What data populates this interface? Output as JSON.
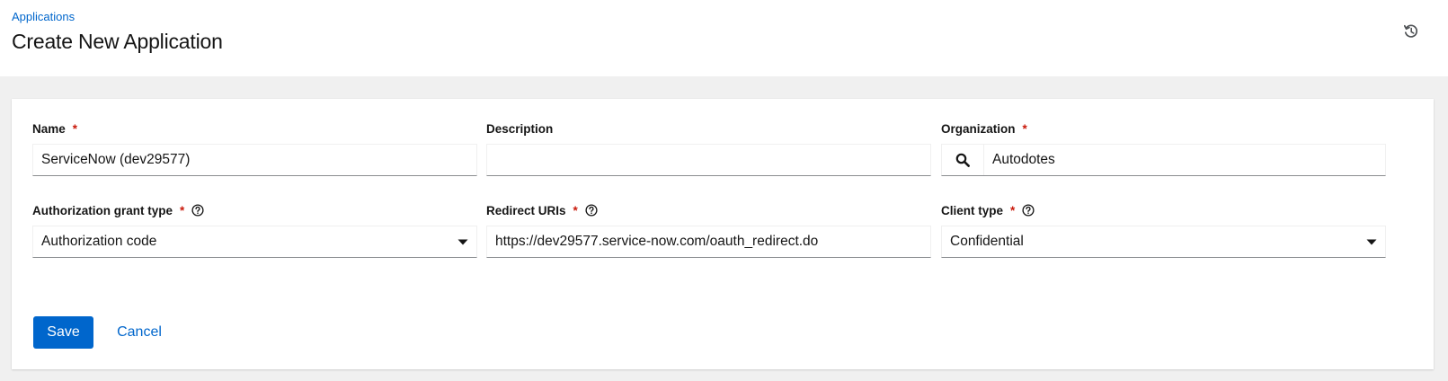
{
  "breadcrumb": {
    "label": "Applications"
  },
  "page": {
    "title": "Create New Application"
  },
  "header": {
    "history_icon": "history-icon"
  },
  "form": {
    "name": {
      "label": "Name",
      "required_mark": "*",
      "value": "ServiceNow (dev29577)"
    },
    "description": {
      "label": "Description",
      "value": ""
    },
    "organization": {
      "label": "Organization",
      "required_mark": "*",
      "value": "Autodotes",
      "search_icon": "search-icon"
    },
    "grant_type": {
      "label": "Authorization grant type",
      "required_mark": "*",
      "value": "Authorization code",
      "help_icon": "help-icon"
    },
    "redirect_uris": {
      "label": "Redirect URIs",
      "required_mark": "*",
      "value": "https://dev29577.service-now.com/oauth_redirect.do",
      "help_icon": "help-icon"
    },
    "client_type": {
      "label": "Client type",
      "required_mark": "*",
      "value": "Confidential",
      "help_icon": "help-icon"
    }
  },
  "actions": {
    "save_label": "Save",
    "cancel_label": "Cancel"
  },
  "colors": {
    "primary": "#0066cc",
    "required": "#c9190b",
    "background": "#f0f0f0",
    "text": "#151515"
  }
}
